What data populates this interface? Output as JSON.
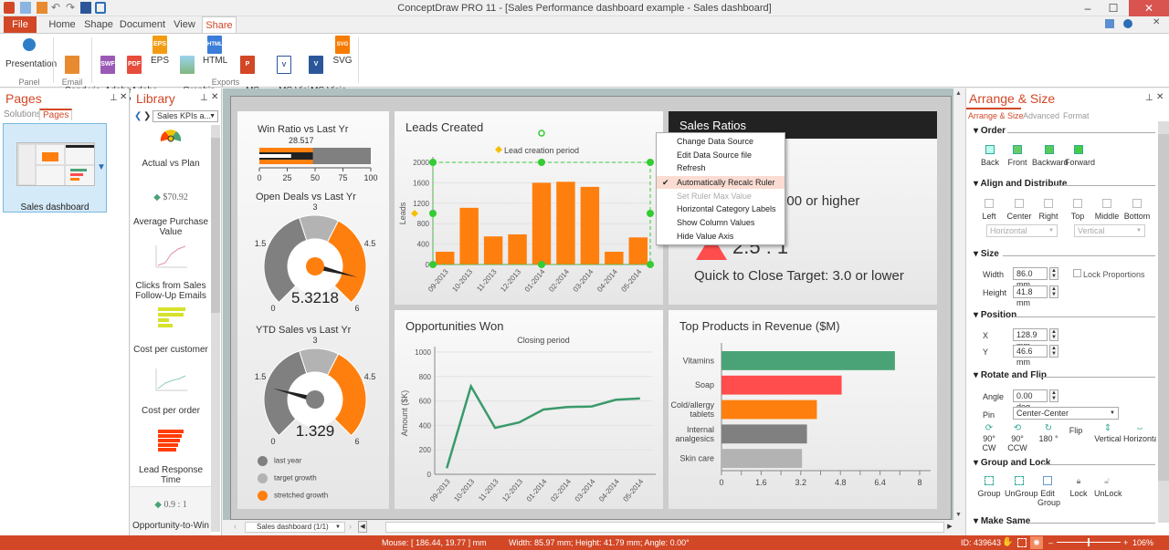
{
  "window": {
    "title": "ConceptDraw PRO 11 - [Sales Performance dashboard example - Sales dashboard]",
    "controls": {
      "minimize": "–",
      "maximize": "☐",
      "close": "✕"
    }
  },
  "ribbon": {
    "tabs": [
      {
        "label": "File"
      },
      {
        "label": "Home"
      },
      {
        "label": "Shape"
      },
      {
        "label": "Document"
      },
      {
        "label": "View"
      },
      {
        "label": "Share"
      }
    ],
    "active_tab": "Share",
    "buttons": [
      {
        "label": "Presentation",
        "icon": "presentation-icon",
        "badge": "",
        "color": "#2f7fc8"
      },
      {
        "label": "Send via\nEmail",
        "icon": "email-icon",
        "badge": "",
        "color": "#e88b30"
      },
      {
        "label": "Adobe\nFlash",
        "icon": "swf-file-icon",
        "badge": "SWF",
        "color": "#9b59b6"
      },
      {
        "label": "Adobe\nPDF",
        "icon": "pdf-file-icon",
        "badge": "PDF",
        "color": "#e74c3c"
      },
      {
        "label": "EPS",
        "icon": "eps-file-icon",
        "badge": "EPS",
        "color": "#f39c12"
      },
      {
        "label": "Graphic\nfile",
        "icon": "image-file-icon",
        "badge": "",
        "color": "#7fb77e"
      },
      {
        "label": "HTML",
        "icon": "html-file-icon",
        "badge": "HTML",
        "color": "#3b7dd8"
      },
      {
        "label": "MS\nPowerPoint",
        "icon": "powerpoint-icon",
        "badge": "P",
        "color": "#d24726"
      },
      {
        "label": "MS Visio\n(VDX)",
        "icon": "visio-vdx-icon",
        "badge": "V",
        "color": "#2b579a"
      },
      {
        "label": "MS Visio\n(VSDX)",
        "icon": "visio-vsdx-icon",
        "badge": "V",
        "color": "#2b579a"
      },
      {
        "label": "SVG",
        "icon": "svg-file-icon",
        "badge": "SVG",
        "color": "#f57c00"
      }
    ],
    "groups": {
      "panel": "Panel",
      "email": "Email",
      "exports": "Exports"
    }
  },
  "pages_panel": {
    "title": "Pages",
    "tabs": [
      {
        "label": "Solutions"
      },
      {
        "label": "Pages"
      }
    ],
    "active_tab": "Pages",
    "pages": [
      {
        "label": "Sales dashboard"
      }
    ]
  },
  "library_panel": {
    "title": "Library",
    "dropdown": "Sales KPIs a...",
    "items": [
      {
        "label": "Actual vs Plan"
      },
      {
        "label": "Average Purchase Value",
        "value": "$70.92"
      },
      {
        "label": "Clicks from Sales Follow-Up Emails"
      },
      {
        "label": "Cost per customer"
      },
      {
        "label": "Cost per order"
      },
      {
        "label": "Lead Response Time"
      },
      {
        "label": "Opportunity-to-Win",
        "value": "0.9 : 1"
      }
    ]
  },
  "dashboard": {
    "win_ratio": {
      "title": "Win Ratio vs Last Yr",
      "value_label": "28.517"
    },
    "open_deals": {
      "title": "Open Deals vs Last Yr",
      "value_label": "5.3218"
    },
    "ytd_sales": {
      "title": "YTD Sales vs Last Yr",
      "value_label": "1.329"
    },
    "gauge_legend": [
      {
        "label": "last year",
        "color": "#808080"
      },
      {
        "label": "target growth",
        "color": "#b3b3b3"
      },
      {
        "label": "stretched growth",
        "color": "#ff7f0e"
      }
    ],
    "leads": {
      "title": "Leads Created"
    },
    "opps": {
      "title": "Opportunities Won"
    },
    "sales_ratios": {
      "title": "Sales Ratios",
      "line1": "et: 1,00 or higher",
      "big_value": "2.5 : 1",
      "line2": "Quick to Close Target: 3.0 or lower"
    },
    "top_products": {
      "title": "Top Products in Revenue ($M)"
    }
  },
  "chart_data": [
    {
      "type": "bar",
      "name": "win-ratio-bullet",
      "title": "Win Ratio vs Last Yr",
      "value": 28.517,
      "bar_value": 48,
      "range_max": 100,
      "ticks": [
        "0",
        "25",
        "50",
        "75",
        "100"
      ],
      "xlim": [
        0,
        100
      ]
    },
    {
      "type": "gauge",
      "name": "open-deals-gauge",
      "title": "Open Deals vs Last Yr",
      "value": 5.3218,
      "range": [
        0,
        6
      ],
      "ticks": [
        "0",
        "1.5",
        "3",
        "4.5",
        "6"
      ],
      "bands": [
        {
          "from": 0,
          "to": 2.6,
          "color": "#808080"
        },
        {
          "from": 2.6,
          "to": 3.6,
          "color": "#b3b3b3"
        },
        {
          "from": 3.6,
          "to": 6,
          "color": "#ff7f0e"
        }
      ],
      "hub_color": "#ff7f0e"
    },
    {
      "type": "gauge",
      "name": "ytd-sales-gauge",
      "title": "YTD Sales vs Last Yr",
      "value": 1.329,
      "range": [
        0,
        6
      ],
      "ticks": [
        "0",
        "1.5",
        "3",
        "4.5",
        "6"
      ],
      "bands": [
        {
          "from": 0,
          "to": 2.6,
          "color": "#808080"
        },
        {
          "from": 2.6,
          "to": 3.6,
          "color": "#b3b3b3"
        },
        {
          "from": 3.6,
          "to": 6,
          "color": "#ff7f0e"
        }
      ],
      "hub_color": "#808080"
    },
    {
      "type": "bar",
      "name": "leads-created",
      "title": "Lead creation period",
      "categories": [
        "09-2013",
        "10-2013",
        "11-2013",
        "12-2013",
        "01-2014",
        "02-2014",
        "03-2014",
        "04-2014",
        "05-2014"
      ],
      "values": [
        250,
        1110,
        550,
        590,
        1600,
        1620,
        1520,
        250,
        530
      ],
      "ylabel": "Leads",
      "ylim": [
        0,
        2000
      ],
      "yticks": [
        "0",
        "400",
        "800",
        "1200",
        "1600",
        "2000"
      ],
      "color": "#ff7f0e",
      "grid": true
    },
    {
      "type": "line",
      "name": "opportunities-won",
      "title": "Closing period",
      "categories": [
        "09-2013",
        "10-2013",
        "11-2013",
        "12-2013",
        "01-2014",
        "02-2014",
        "03-2014",
        "04-2014",
        "05-2014"
      ],
      "values": [
        50,
        720,
        380,
        425,
        530,
        550,
        555,
        610,
        620
      ],
      "ylabel": "Amount ($K)",
      "ylim": [
        0,
        1000
      ],
      "yticks": [
        "0",
        "200",
        "400",
        "600",
        "800",
        "1000"
      ],
      "color": "#3a9a6a",
      "grid": true
    },
    {
      "type": "bar",
      "orientation": "horizontal",
      "name": "top-products",
      "title": "Top Products in Revenue ($M)",
      "categories": [
        "Vitamins",
        "Soap",
        "Cold/allergy tablets",
        "Internal analgesics",
        "Skin care"
      ],
      "values": [
        7.0,
        4.85,
        3.85,
        3.45,
        3.25
      ],
      "colors": [
        "#4aa376",
        "#ff4d4d",
        "#ff7f0e",
        "#808080",
        "#b3b3b3"
      ],
      "xlim": [
        0,
        8
      ],
      "xticks": [
        "0",
        "1.6",
        "3.2",
        "4.8",
        "6.4",
        "8"
      ]
    }
  ],
  "context_menu": {
    "items": [
      {
        "label": "Change Data Source",
        "state": "normal"
      },
      {
        "label": "Edit Data Source file",
        "state": "normal"
      },
      {
        "label": "Refresh",
        "state": "normal"
      },
      {
        "label": "Automatically Recalc Ruler",
        "state": "checked"
      },
      {
        "label": "Set Ruler Max Value",
        "state": "disabled"
      },
      {
        "label": "Horizontal Category Labels",
        "state": "normal"
      },
      {
        "label": "Show Column Values",
        "state": "normal"
      },
      {
        "label": "Hide Value Axis",
        "state": "normal"
      }
    ]
  },
  "arrange_panel": {
    "title": "Arrange & Size",
    "tabs": [
      {
        "label": "Arrange & Size"
      },
      {
        "label": "Advanced"
      },
      {
        "label": "Format"
      }
    ],
    "order": {
      "title": "Order",
      "buttons": [
        "Back",
        "Front",
        "Backward",
        "Forward"
      ]
    },
    "align": {
      "title": "Align and Distribute",
      "buttons": [
        "Left",
        "Center",
        "Right",
        "Top",
        "Middle",
        "Bottom"
      ],
      "horizontal": "Horizontal",
      "vertical": "Vertical"
    },
    "size": {
      "title": "Size",
      "width_label": "Width",
      "width": "86.0 mm",
      "height_label": "Height",
      "height": "41.8 mm",
      "lock": "Lock Proportions"
    },
    "position": {
      "title": "Position",
      "x_label": "X",
      "x": "128.9 mm",
      "y_label": "Y",
      "y": "46.6 mm"
    },
    "rotate": {
      "title": "Rotate and Flip",
      "angle_label": "Angle",
      "angle": "0.00 deg",
      "pin_label": "Pin",
      "pin": "Center-Center",
      "buttons": [
        "90° CW",
        "90° CCW",
        "180 °",
        "Flip",
        "Vertical",
        "Horizonta"
      ]
    },
    "group": {
      "title": "Group and Lock",
      "buttons": [
        "Group",
        "UnGroup",
        "Edit Group",
        "Lock",
        "UnLock"
      ]
    },
    "make_same": {
      "title": "Make Same"
    }
  },
  "bottom": {
    "page_selector": "Sales dashboard (1/1)"
  },
  "status": {
    "mouse": "Mouse: [ 186.44, 19.77 ] mm",
    "dims": "Width: 85.97 mm;  Height: 41.79 mm;  Angle: 0.00°",
    "id": "ID: 439643",
    "zoom": "106%"
  }
}
